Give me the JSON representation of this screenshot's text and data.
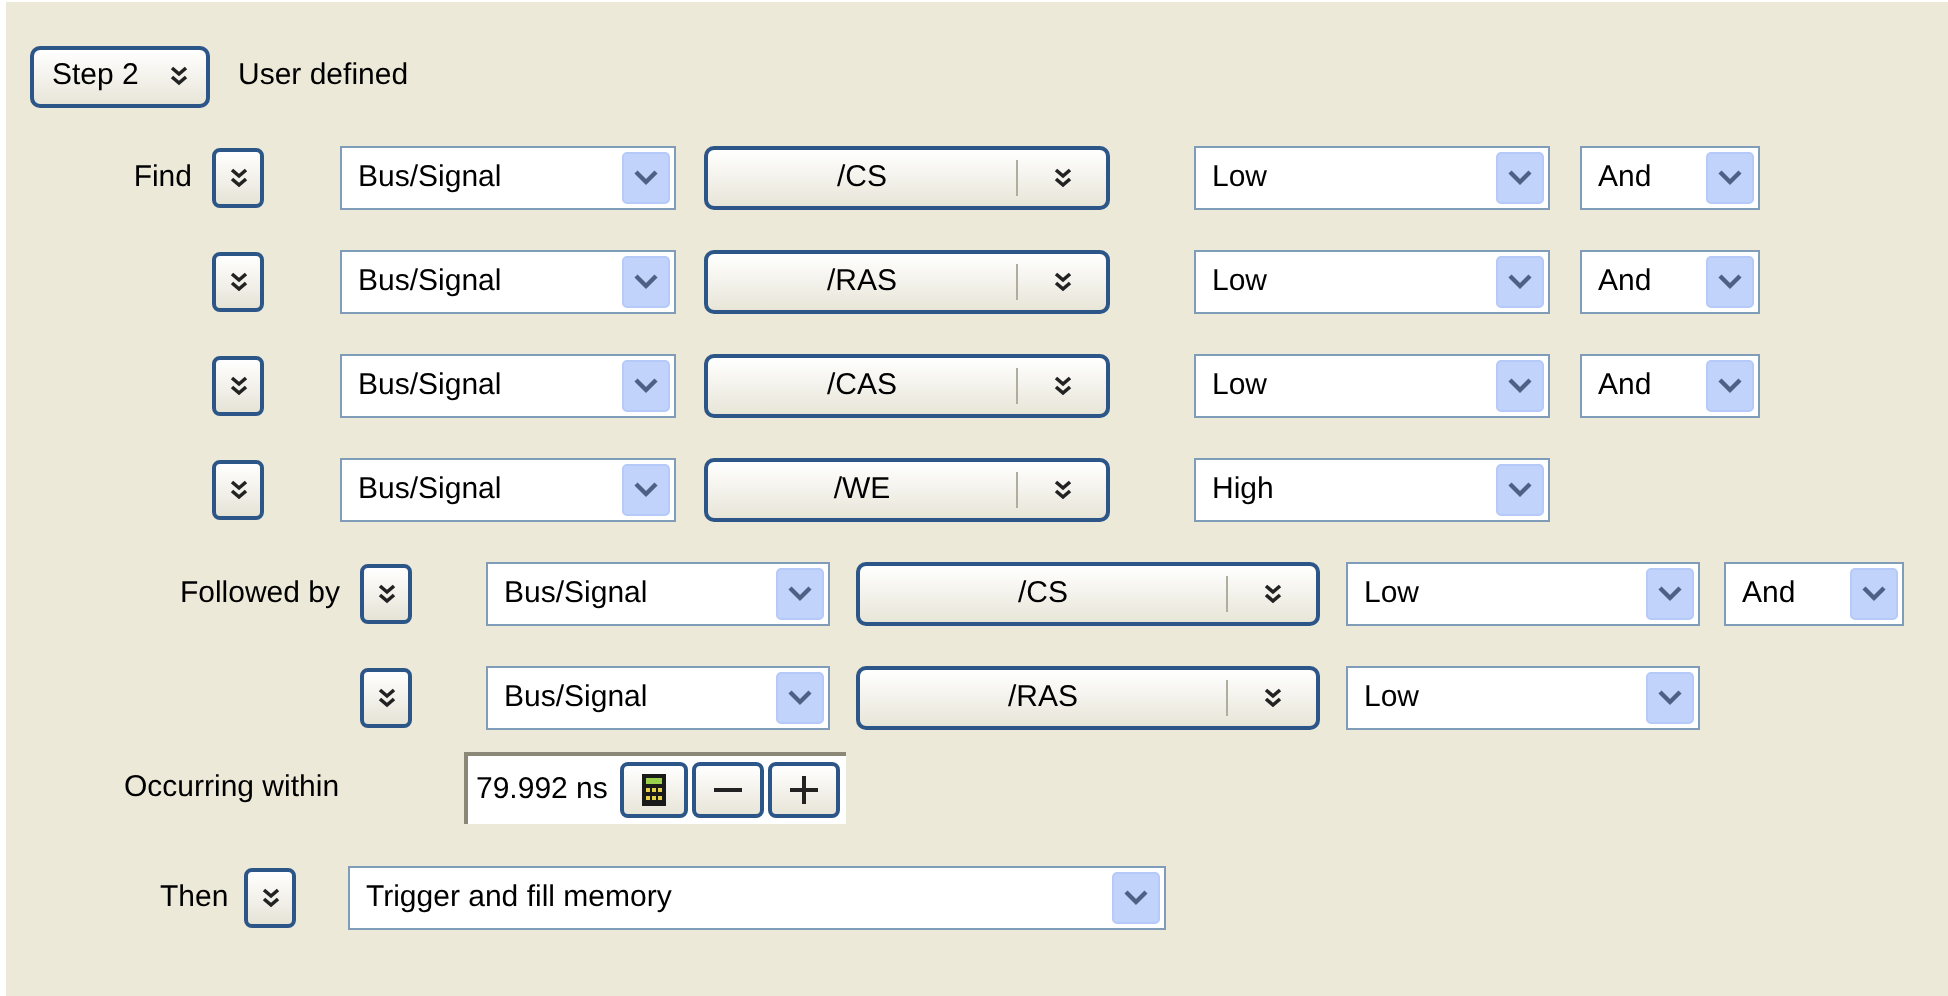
{
  "step": {
    "label": "Step 2",
    "mode": "User defined"
  },
  "find": {
    "label": "Find",
    "conditions": [
      {
        "type": "Bus/Signal",
        "signal": "/CS",
        "value": "Low",
        "operator": "And"
      },
      {
        "type": "Bus/Signal",
        "signal": "/RAS",
        "value": "Low",
        "operator": "And"
      },
      {
        "type": "Bus/Signal",
        "signal": "/CAS",
        "value": "Low",
        "operator": "And"
      },
      {
        "type": "Bus/Signal",
        "signal": "/WE",
        "value": "High"
      }
    ]
  },
  "followed_by": {
    "label": "Followed by",
    "conditions": [
      {
        "type": "Bus/Signal",
        "signal": "/CS",
        "value": "Low",
        "operator": "And"
      },
      {
        "type": "Bus/Signal",
        "signal": "/RAS",
        "value": "Low"
      }
    ]
  },
  "occurring_within": {
    "label": "Occurring within",
    "value": "79.992 ns"
  },
  "then": {
    "label": "Then",
    "action": "Trigger and fill memory"
  }
}
